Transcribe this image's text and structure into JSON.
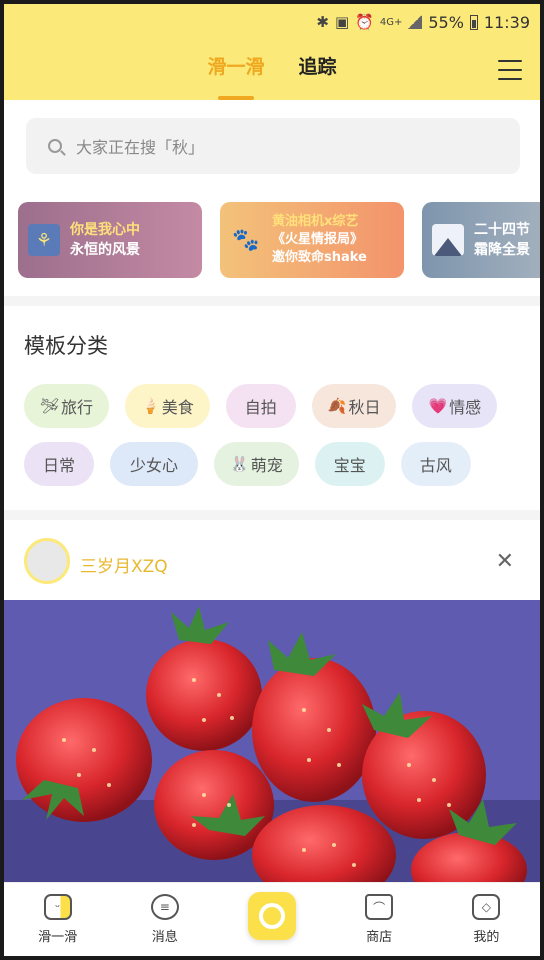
{
  "status_bar": {
    "icons": [
      "bluetooth-icon",
      "nfc-icon",
      "alarm-icon",
      "4g-icon",
      "signal-icon"
    ],
    "network": "4G+",
    "battery": "55%",
    "time": "11:39"
  },
  "header": {
    "tabs": [
      {
        "label": "滑一滑",
        "active": true
      },
      {
        "label": "追踪",
        "active": false
      }
    ],
    "menu_icon": "hamburger-menu-icon",
    "accent_color": "#f0a820",
    "bar_color": "#fbe97a"
  },
  "search": {
    "placeholder": "大家正在搜「秋」",
    "icon": "search-icon"
  },
  "banners": [
    {
      "line1": "你是我心中",
      "line2": "永恒的风景",
      "icon": "grain-icon"
    },
    {
      "line1": "黄油相机x综艺",
      "line2": "《火星情报局》",
      "line3": "邀你致命shake",
      "icon": "cats-icon"
    },
    {
      "line1": "二十四节",
      "line2": "霜降全景",
      "icon": "mountain-icon"
    }
  ],
  "categories": {
    "title": "模板分类",
    "row1": [
      {
        "label": "旅行",
        "emoji": "🛩",
        "color": "#e8f4d8"
      },
      {
        "label": "美食",
        "emoji": "🍦",
        "color": "#fdf4c8"
      },
      {
        "label": "自拍",
        "emoji": "",
        "color": "#f4e2f2"
      },
      {
        "label": "秋日",
        "emoji": "🍂",
        "color": "#f6e6dc"
      },
      {
        "label": "情感",
        "emoji": "💗",
        "color": "#e8e4f8"
      }
    ],
    "row2": [
      {
        "label": "日常",
        "emoji": "",
        "color": "#ece2f6"
      },
      {
        "label": "少女心",
        "emoji": "",
        "color": "#dde8f8"
      },
      {
        "label": "萌宠",
        "emoji": "🐰",
        "color": "#e6f2e0"
      },
      {
        "label": "宝宝",
        "emoji": "",
        "color": "#dcf2f2"
      },
      {
        "label": "古风",
        "emoji": "",
        "color": "#e4eef8"
      }
    ]
  },
  "post": {
    "username": "三岁月XZQ",
    "close_icon": "close-icon",
    "image_subject": "strawberries"
  },
  "bottom_nav": [
    {
      "label": "滑一滑",
      "icon": "home-card-icon"
    },
    {
      "label": "消息",
      "icon": "message-icon"
    },
    {
      "label": "",
      "icon": "camera-icon"
    },
    {
      "label": "商店",
      "icon": "shop-icon"
    },
    {
      "label": "我的",
      "icon": "profile-icon"
    }
  ]
}
